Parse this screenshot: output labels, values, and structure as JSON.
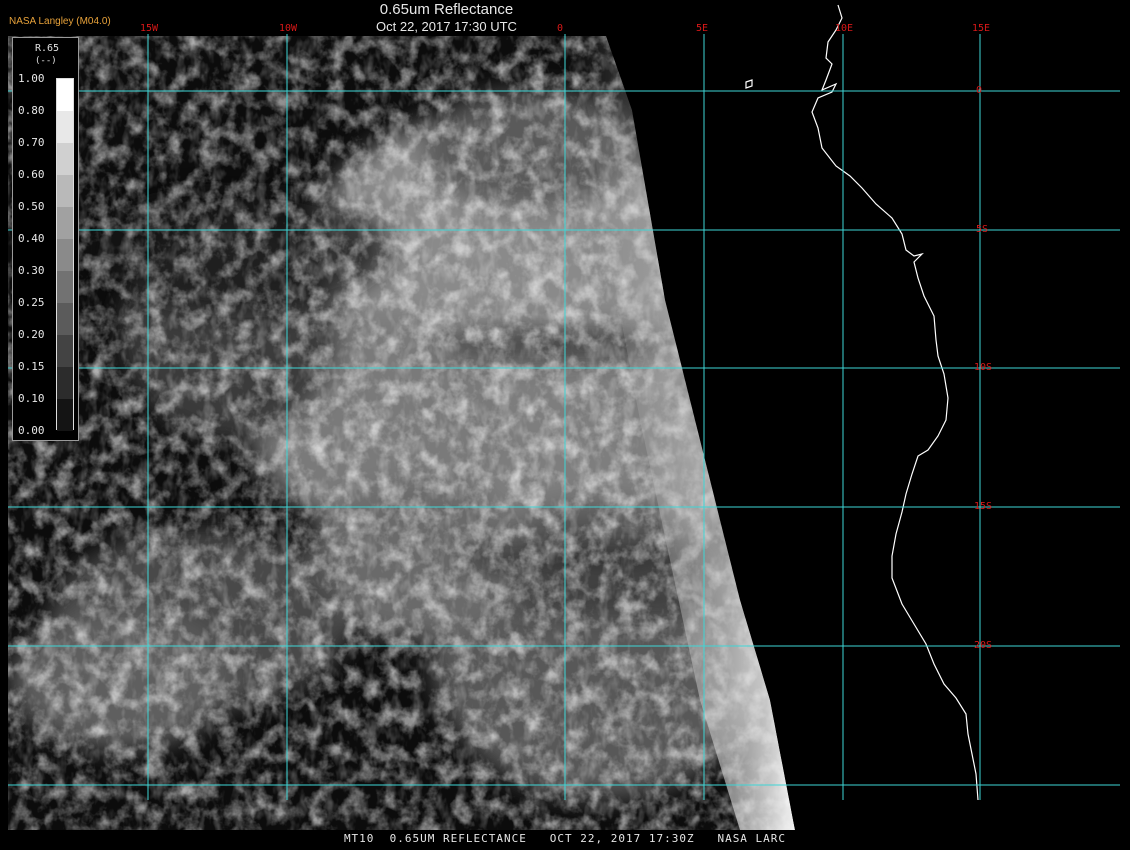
{
  "title": {
    "line1": "0.65um Reflectance",
    "line2": "Oct 22, 2017 17:30 UTC"
  },
  "brand": "NASA Langley (M04.0)",
  "colorbar": {
    "variable": "R.65",
    "unit": "(--)",
    "ticks": [
      "1.00",
      "0.80",
      "0.70",
      "0.60",
      "0.50",
      "0.40",
      "0.30",
      "0.25",
      "0.20",
      "0.15",
      "0.10",
      "0.00"
    ]
  },
  "grid": {
    "longitudes": [
      "15W",
      "10W",
      "0",
      "5E",
      "10E",
      "15E"
    ],
    "latitudes": [
      "0",
      "5S",
      "10S",
      "15S",
      "20S"
    ],
    "line_color": "#3ed6d6",
    "label_color": "#d81818"
  },
  "coastline_color": "#ffffff",
  "footer": "MT10  0.65UM REFLECTANCE   OCT 22, 2017 17:30Z   NASA LARC",
  "icons": [
    "colorbar-legend-icon"
  ]
}
